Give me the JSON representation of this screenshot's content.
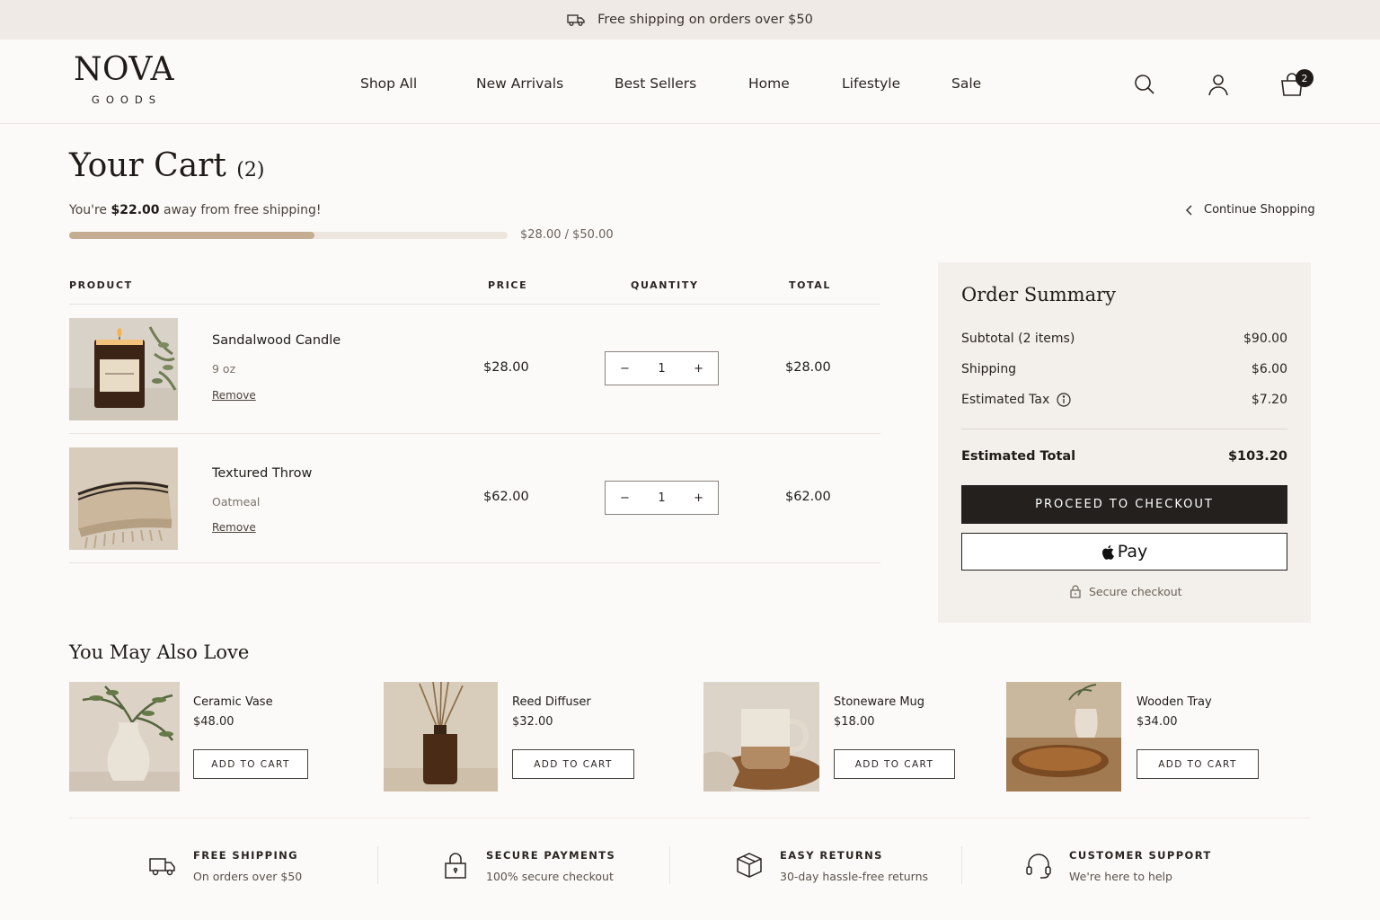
{
  "announcement": "Free shipping on orders over $50",
  "brand": {
    "name": "NOVA",
    "sub": "GOODS"
  },
  "nav": [
    "Shop All",
    "New Arrivals",
    "Best Sellers",
    "Home",
    "Lifestyle",
    "Sale"
  ],
  "cart_count": "2",
  "page": {
    "title": "Your Cart",
    "count": "(2)",
    "ship_msg_pre": "You're ",
    "ship_msg_amount": "$22.00",
    "ship_msg_post": " away from free shipping!",
    "progress_text": "$28.00 / $50.00",
    "progress_fraction": 0.56,
    "continue": "Continue Shopping"
  },
  "table": {
    "headers": {
      "product": "PRODUCT",
      "price": "PRICE",
      "quantity": "QUANTITY",
      "total": "TOTAL"
    },
    "items": [
      {
        "name": "Sandalwood Candle",
        "variant": "9 oz",
        "remove": "Remove",
        "price": "$28.00",
        "qty": "1",
        "total": "$28.00",
        "label_text": "SANDALWOOD"
      },
      {
        "name": "Textured Throw",
        "variant": "Oatmeal",
        "remove": "Remove",
        "price": "$62.00",
        "qty": "1",
        "total": "$62.00"
      }
    ],
    "minus": "−",
    "plus": "+"
  },
  "summary": {
    "title": "Order Summary",
    "subtotal_label": "Subtotal (2 items)",
    "subtotal": "$90.00",
    "shipping_label": "Shipping",
    "shipping": "$6.00",
    "tax_label": "Estimated Tax",
    "tax": "$7.20",
    "total_label": "Estimated Total",
    "total": "$103.20",
    "checkout": "PROCEED TO CHECKOUT",
    "applepay": "Pay",
    "secure": "Secure checkout"
  },
  "recommendations": {
    "title": "You May Also Love",
    "items": [
      {
        "name": "Ceramic Vase",
        "price": "$48.00",
        "button": "ADD TO CART"
      },
      {
        "name": "Reed Diffuser",
        "price": "$32.00",
        "button": "ADD TO CART"
      },
      {
        "name": "Stoneware Mug",
        "price": "$18.00",
        "button": "ADD TO CART"
      },
      {
        "name": "Wooden Tray",
        "price": "$34.00",
        "button": "ADD TO CART"
      }
    ]
  },
  "features": [
    {
      "title": "FREE SHIPPING",
      "text": "On orders over $50",
      "icon": "truck-icon"
    },
    {
      "title": "SECURE PAYMENTS",
      "text": "100% secure checkout",
      "icon": "lock-icon"
    },
    {
      "title": "EASY RETURNS",
      "text": "30-day hassle-free returns",
      "icon": "box-icon"
    },
    {
      "title": "CUSTOMER SUPPORT",
      "text": "We're here to help",
      "icon": "headset-icon"
    }
  ]
}
